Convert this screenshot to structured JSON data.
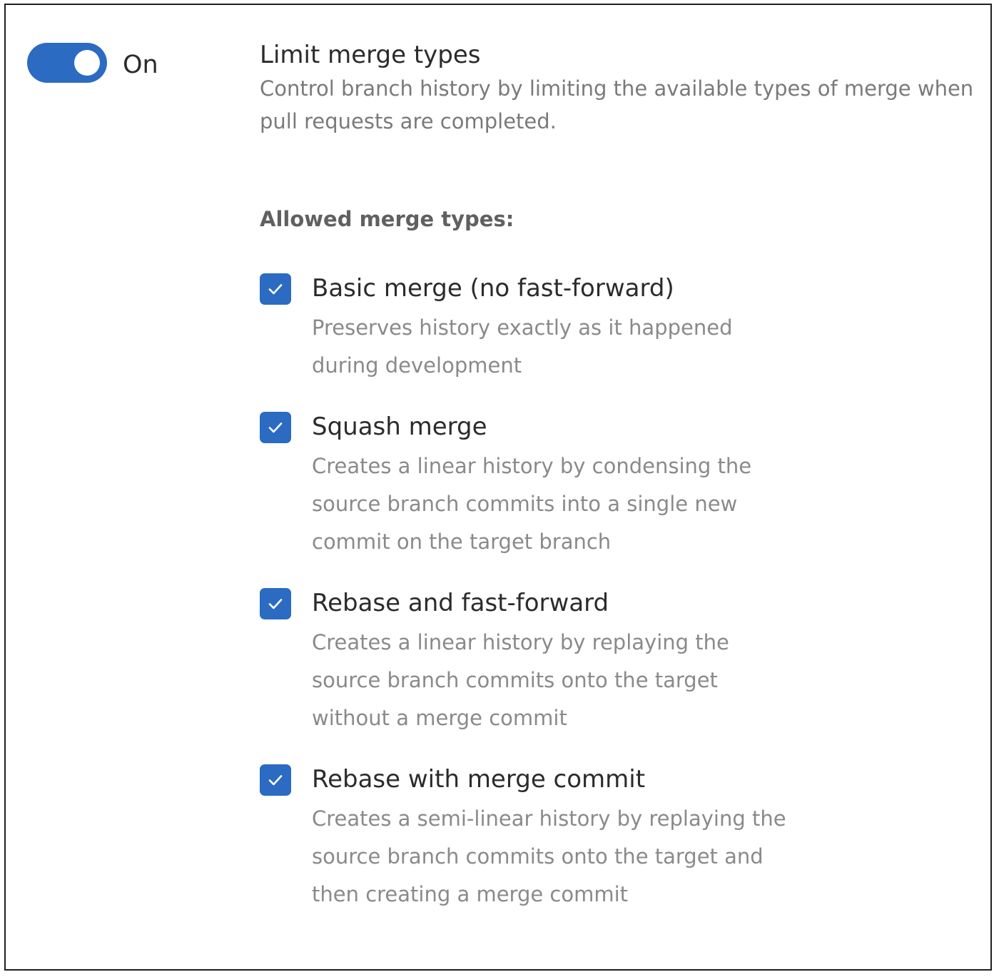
{
  "toggle": {
    "state_label": "On",
    "on": true,
    "color": "#2b6bc1"
  },
  "setting": {
    "title": "Limit merge types",
    "description": "Control branch history by limiting the available types of merge when pull requests are completed."
  },
  "allowed": {
    "label": "Allowed merge types:",
    "options": [
      {
        "title": "Basic merge (no fast-forward)",
        "description": "Preserves history exactly as it happened during development",
        "checked": true
      },
      {
        "title": "Squash merge",
        "description": "Creates a linear history by condensing the source branch commits into a single new commit on the target branch",
        "checked": true
      },
      {
        "title": "Rebase and fast-forward",
        "description": "Creates a linear history by replaying the source branch commits onto the target without a merge commit",
        "checked": true
      },
      {
        "title": "Rebase with merge commit",
        "description": "Creates a semi-linear history by replaying the source branch commits onto the target and then creating a merge commit",
        "checked": true
      }
    ]
  },
  "icons": {
    "checkbox": "checkmark-icon",
    "toggle": "toggle-switch"
  }
}
